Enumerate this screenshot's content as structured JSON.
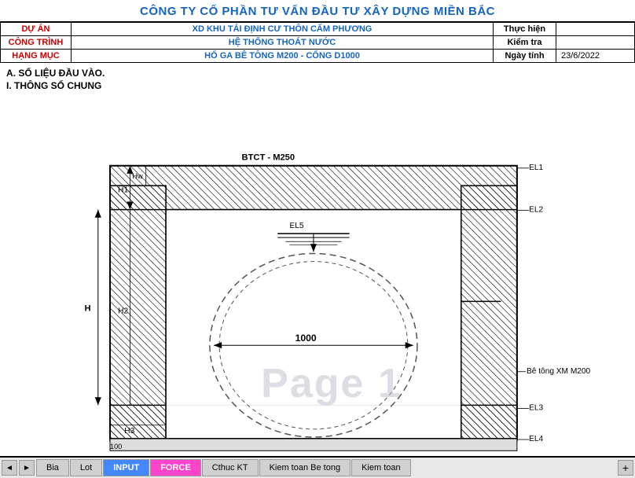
{
  "header": {
    "title": "CÔNG TY CỔ PHẦN TƯ VẤN ĐẦU TƯ XÂY DỰNG MIỀN BẮC"
  },
  "info_rows": [
    {
      "label": "DỰ ÁN",
      "value": "XD KHU TÁI ĐỊNH CƯ THÔN CẤM PHƯƠNG",
      "sublabel": "Thực hiện",
      "subvalue": ""
    },
    {
      "label": "CÔNG TRÌNH",
      "value": "HỆ THỐNG THOÁT NƯỚC",
      "sublabel": "Kiểm tra",
      "subvalue": ""
    },
    {
      "label": "HẠNG MỤC",
      "value": "HỐ GA BÊ TÔNG M200 - CỐNG D1000",
      "sublabel": "Ngày tính",
      "subvalue": "23/6/2022"
    }
  ],
  "sections": {
    "title1": "A. SỐ LIỆU ĐẦU VÀO.",
    "title2": "I. THÔNG SỐ CHUNG"
  },
  "drawing": {
    "btct_label": "BTCT - M250",
    "el1_label": "EL1",
    "el2_label": "EL2",
    "el5_label": "EL5",
    "el3_label": "EL3",
    "el4_label": "EL4",
    "h_label": "H",
    "h1_label": "H1",
    "h2_label": "H2",
    "h3_label": "H3",
    "hw_label": "Hw",
    "diameter_label": "1000",
    "be_tong_label": "Bê tông XM M200",
    "h3_dim": "100"
  },
  "tabs": [
    {
      "label": "Bia",
      "state": "normal"
    },
    {
      "label": "Lot",
      "state": "normal"
    },
    {
      "label": "INPUT",
      "state": "active-blue"
    },
    {
      "label": "FORCE",
      "state": "active-pink"
    },
    {
      "label": "Cthuc KT",
      "state": "normal"
    },
    {
      "label": "Kiem toan Be tong",
      "state": "normal"
    },
    {
      "label": "Kiem toan",
      "state": "normal"
    }
  ],
  "nav_prev": "◄",
  "nav_next": "►",
  "tab_add": "+"
}
